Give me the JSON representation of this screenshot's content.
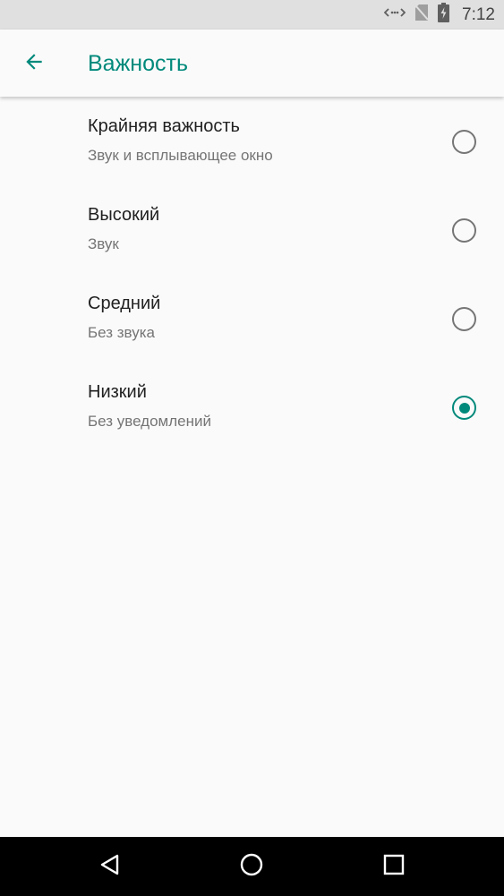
{
  "status_bar": {
    "time": "7:12",
    "icons": [
      "data-saver-icon",
      "no-sim-icon",
      "battery-charging-icon"
    ]
  },
  "app_bar": {
    "title": "Важность",
    "back_icon": "arrow-back-icon"
  },
  "options": [
    {
      "title": "Крайняя важность",
      "summary": "Звук и всплывающее окно",
      "selected": false
    },
    {
      "title": "Высокий",
      "summary": "Звук",
      "selected": false
    },
    {
      "title": "Средний",
      "summary": "Без звука",
      "selected": false
    },
    {
      "title": "Низкий",
      "summary": "Без уведомлений",
      "selected": true
    }
  ],
  "nav_bar": {
    "icons": [
      "back-triangle-icon",
      "home-circle-icon",
      "recents-square-icon"
    ]
  },
  "colors": {
    "accent": "#00897b",
    "status_bar": "#e0e0e0",
    "background": "#fafafa",
    "nav_bar": "#000000"
  }
}
